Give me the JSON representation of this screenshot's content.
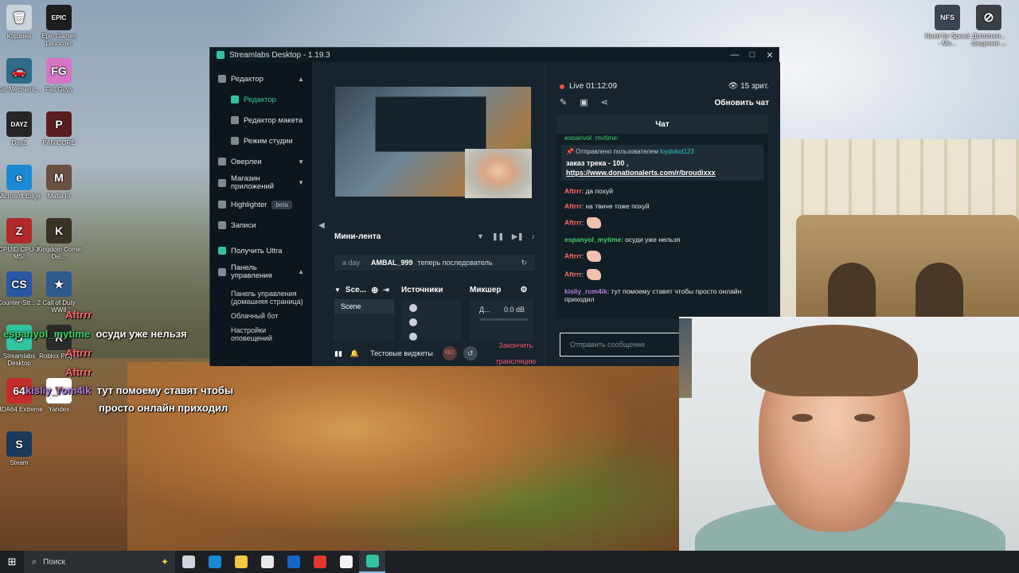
{
  "desktop": {
    "icons_left": [
      {
        "label": "Корзина",
        "color": "#c9d3da",
        "glyph": "🗑"
      },
      {
        "label": "Epic Games Launcher",
        "color": "#1e1e1e",
        "glyph": "EPIC"
      },
      {
        "label": "Car Mechanic...",
        "color": "#2e6b88",
        "glyph": "🚗"
      },
      {
        "label": "Fall Guys",
        "color": "#d774c6",
        "glyph": "FG"
      },
      {
        "label": "DayZ",
        "color": "#262626",
        "glyph": "DAYZ"
      },
      {
        "label": "PANICORE",
        "color": "#5a1d1d",
        "glyph": "P"
      },
      {
        "label": "Microsoft Edge",
        "color": "#1a8ad4",
        "glyph": "e"
      },
      {
        "label": "Mafia III",
        "color": "#6b5141",
        "glyph": "M"
      },
      {
        "label": "CPUID CPU-Z MSI",
        "color": "#b02a2a",
        "glyph": "Z"
      },
      {
        "label": "Kingdom Come Del...",
        "color": "#3a3222",
        "glyph": "K"
      },
      {
        "label": "Counter-Str... 2",
        "color": "#2957a4",
        "glyph": "CS"
      },
      {
        "label": "Call of Duty WWII",
        "color": "#2f5a8f",
        "glyph": "★"
      },
      {
        "label": "Streamlabs Desktop",
        "color": "#31c3a2",
        "glyph": "S"
      },
      {
        "label": "Roblox Player",
        "color": "#2b2b2b",
        "glyph": "R"
      },
      {
        "label": "AIDA64 Extreme",
        "color": "#c42c2c",
        "glyph": "64"
      },
      {
        "label": "Yandex",
        "color": "#ffffff",
        "glyph": "Y"
      },
      {
        "label": "Steam",
        "color": "#1b3a5c",
        "glyph": "S"
      }
    ],
    "icons_right": [
      {
        "label": "Need for Speed - Mo...",
        "color": "#3b4552",
        "glyph": "NFS"
      },
      {
        "label": "Дополнит... сведения ...",
        "color": "#3a3f45",
        "glyph": "⊘"
      }
    ]
  },
  "window": {
    "title": "Streamlabs Desktop - 1.19.3",
    "controls": [
      "—",
      "□",
      "✕"
    ],
    "sidebar": {
      "editor": "Редактор",
      "editor_sub": [
        "Редактор",
        "Редактор макета",
        "Режим студии"
      ],
      "overlays": "Оверлеи",
      "app_store": "Магазин приложений",
      "highlighter": "Highlighter",
      "beta": "beta",
      "recordings": "Записи",
      "ultra": "Получить Ultra",
      "dashboard": "Панель управления",
      "dashboard_sub": [
        "Панель управления (домашняя страница)",
        "Облачный бот",
        "Настройки оповещений"
      ]
    },
    "centre": {
      "feed_title": "Мини-лента",
      "feed_ago": "a day",
      "feed_user": "AMBAL_999",
      "feed_text": "теперь последователь",
      "scenes": "Sce...",
      "sources": "Источники",
      "mixer": "Микшер",
      "scene_item": "Scene",
      "mixer_label": "Д...",
      "mixer_db": "0.0 dB",
      "test_widgets": "Тестовые виджеты",
      "rec": "REC",
      "end_stream": "Закончить трансляцию"
    },
    "chat": {
      "live": "Live 01:12:09",
      "viewers": "15 зрит.",
      "refresh": "Обновить чат",
      "tab": "Чат",
      "top_cut": "espanyol_mytime:",
      "pinned_by": "Отправлено пользователем",
      "pinned_user": "loydokol123",
      "pinned_text": "заказ трека - 100 ,",
      "pinned_link": "https://www.donationalerts.com/r/broudixxx",
      "messages": [
        {
          "user": "Aftrrr",
          "color": "#ff6b6b",
          "text": ": да похуй",
          "emote": false
        },
        {
          "user": "Aftrrr",
          "color": "#ff6b6b",
          "text": ": на твиче тоже похуй",
          "emote": false
        },
        {
          "user": "Aftrrr",
          "color": "#ff6b6b",
          "text": ":",
          "emote": true
        },
        {
          "user": "espanyol_mytime",
          "color": "#3fd06b",
          "text": ": осуди уже нельзя",
          "emote": false
        },
        {
          "user": "Aftrrr",
          "color": "#ff6b6b",
          "text": ":",
          "emote": true
        },
        {
          "user": "Aftrrr",
          "color": "#ff6b6b",
          "text": ":",
          "emote": true
        },
        {
          "user": "kisliy_rom4ik",
          "color": "#b07de0",
          "text": ": тут помоему ставят чтобы просто онлайн приходил",
          "emote": false
        }
      ],
      "input_placeholder": "Отправить сообщение"
    }
  },
  "overlay": {
    "line1_user": "Aftrrr",
    "line2_user": "espanyol_mytime",
    "line2_text": "осуди уже нельзя",
    "line3_user": "Aftrrr",
    "line4_user": "Aftrrr",
    "line5_user": "kisliy_rom4ik",
    "line5_text": "тут помоему ставят чтобы",
    "line6_text": "просто онлайн приходил"
  },
  "taskbar": {
    "search": "Поиск",
    "apps": [
      {
        "name": "task-view",
        "color": "#cfd6db"
      },
      {
        "name": "edge",
        "color": "#1a8ad4"
      },
      {
        "name": "file-explorer",
        "color": "#f2c744"
      },
      {
        "name": "store",
        "color": "#e8e8e8"
      },
      {
        "name": "outlook",
        "color": "#1467c7"
      },
      {
        "name": "yandex",
        "color": "#e23a2f"
      },
      {
        "name": "yandex-browser",
        "color": "#f4f4f4"
      },
      {
        "name": "streamlabs",
        "color": "#31c3a2"
      }
    ]
  }
}
